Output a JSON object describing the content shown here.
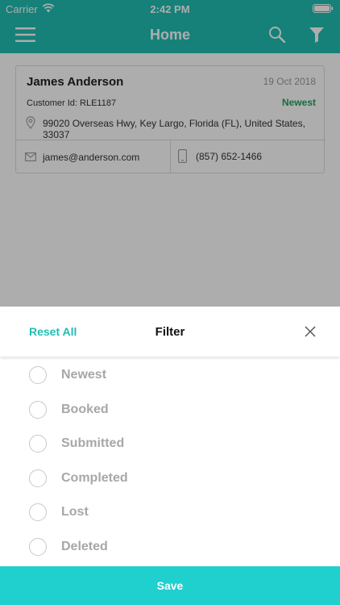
{
  "status_bar": {
    "carrier": "Carrier",
    "time": "2:42 PM"
  },
  "header": {
    "title": "Home",
    "icons": [
      "menu-icon",
      "search-icon",
      "filter-icon"
    ]
  },
  "card": {
    "name": "James Anderson",
    "date": "19 Oct 2018",
    "customer_id": "Customer Id: RLE1187",
    "status": "Newest",
    "address": "99020 Overseas Hwy, Key Largo, Florida (FL), United States, 33037",
    "email": "james@anderson.com",
    "phone": "(857) 652-1466"
  },
  "filter_sheet": {
    "reset_label": "Reset All",
    "title": "Filter",
    "options": [
      {
        "label": "Newest",
        "selected": false
      },
      {
        "label": "Booked",
        "selected": false
      },
      {
        "label": "Submitted",
        "selected": false
      },
      {
        "label": "Completed",
        "selected": false
      },
      {
        "label": "Lost",
        "selected": false
      },
      {
        "label": "Deleted",
        "selected": false
      }
    ],
    "save_label": "Save"
  },
  "colors": {
    "header_bg": "#1fbfb3",
    "accent": "#1fbfb3",
    "save_bg": "#1fd0cf",
    "status_newest": "#22a35a",
    "option_text": "#a7a7a7"
  }
}
